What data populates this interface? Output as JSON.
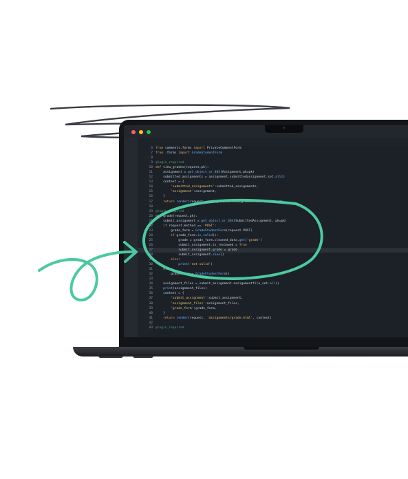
{
  "colors": {
    "accent": "#4cc9a0",
    "scribble": "#3a3d44",
    "dot_close": "#ff5f57",
    "dot_minimize": "#febc2e",
    "dot_zoom": "#28c840",
    "kw": "#e6a65a",
    "str": "#e8c46a",
    "fn": "#6cb6ff",
    "deco": "#4f9e6d"
  },
  "icons": {
    "arrow": "arrow-right-icon",
    "circle": "hand-drawn-circle-icon",
    "scribble": "scribble-lines-icon"
  },
  "editor": {
    "lines": [
      {
        "n": "6",
        "text": "from comments.forms import PrivateCommentForm"
      },
      {
        "n": "7",
        "text": "from .forms import GradeStudentForm"
      },
      {
        "n": "8",
        "text": ""
      },
      {
        "n": "9",
        "text": "@login_required"
      },
      {
        "n": "10",
        "text": "def view_grades(request,pk):"
      },
      {
        "n": "11",
        "text": "    assignment = get_object_or_404(Assignment,pk=pk)"
      },
      {
        "n": "12",
        "text": "    submitted_assignments = assignment.submittedassignment_set.all()"
      },
      {
        "n": "13",
        "text": "    context = {"
      },
      {
        "n": "14",
        "text": "        'submitted_assignments':submitted_assignments,"
      },
      {
        "n": "15",
        "text": "        'assignment':assignment,"
      },
      {
        "n": "16",
        "text": "    }"
      },
      {
        "n": "17",
        "text": "    return render(request, 'assignments/view_grades.html', context)"
      },
      {
        "n": "18",
        "text": ""
      },
      {
        "n": "19",
        "text": "@login_required"
      },
      {
        "n": "20",
        "text": "def grade(request,pk):"
      },
      {
        "n": "21",
        "text": "    submit_assignment = get_object_or_404(SubmittedAssignment, pk=pk)"
      },
      {
        "n": "22",
        "text": "    if request.method == 'POST':"
      },
      {
        "n": "23",
        "text": "        grade_form = GradeStudentForm(request.POST)"
      },
      {
        "n": "24",
        "text": "        if grade_form.is_valid():"
      },
      {
        "n": "25",
        "text": "            grade = grade_form.cleaned_data.get('grade')"
      },
      {
        "n": "26",
        "text": "            submit_assignment.is_reviewed = True"
      },
      {
        "n": "27",
        "text": "            submit_assignment.grade = grade"
      },
      {
        "n": "28",
        "text": "            submit_assignment.save()"
      },
      {
        "n": "29",
        "text": "        else:"
      },
      {
        "n": "30",
        "text": "            print('not valid')"
      },
      {
        "n": "31",
        "text": "    else:"
      },
      {
        "n": "32",
        "text": "        grade_form = GradeStudentForm()"
      },
      {
        "n": "33",
        "text": ""
      },
      {
        "n": "34",
        "text": "    assignment_files = submit_assignment.assignmentfile_set.all()"
      },
      {
        "n": "35",
        "text": "    print(assignment_files)"
      },
      {
        "n": "36",
        "text": "    context = {"
      },
      {
        "n": "37",
        "text": "        'submit_assignment':submit_assignment,"
      },
      {
        "n": "38",
        "text": "        'assignment_files':assignment_files,"
      },
      {
        "n": "39",
        "text": "        'grade_form':grade_form,"
      },
      {
        "n": "40",
        "text": "    }"
      },
      {
        "n": "41",
        "text": "    return render(request, 'assignments/grade.html', context)"
      },
      {
        "n": "42",
        "text": ""
      },
      {
        "n": "43",
        "text": "@login_required"
      }
    ],
    "highlighted_line": "27"
  }
}
